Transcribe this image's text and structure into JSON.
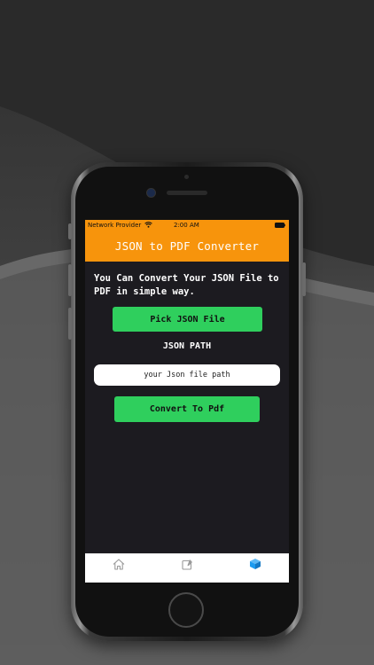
{
  "status_bar": {
    "carrier": "Network Provider",
    "time": "2:00 AM"
  },
  "header": {
    "title": "JSON to PDF Converter"
  },
  "main": {
    "intro": "You Can Convert Your JSON File to PDF in simple way.",
    "pick_button": "Pick JSON File",
    "path_label": "JSON PATH",
    "path_field_text": "your Json file path",
    "convert_button": "Convert To Pdf"
  },
  "tab_bar": {
    "tabs": [
      {
        "icon": "home-icon",
        "active": false
      },
      {
        "icon": "edit-icon",
        "active": false
      },
      {
        "icon": "cube-icon",
        "active": true
      }
    ]
  },
  "colors": {
    "accent": "#f7940c",
    "button": "#2fcf5d",
    "screen_bg": "#1c1b20",
    "active_tab": "#1d9bf0",
    "inactive_tab": "#9a9a9a"
  }
}
